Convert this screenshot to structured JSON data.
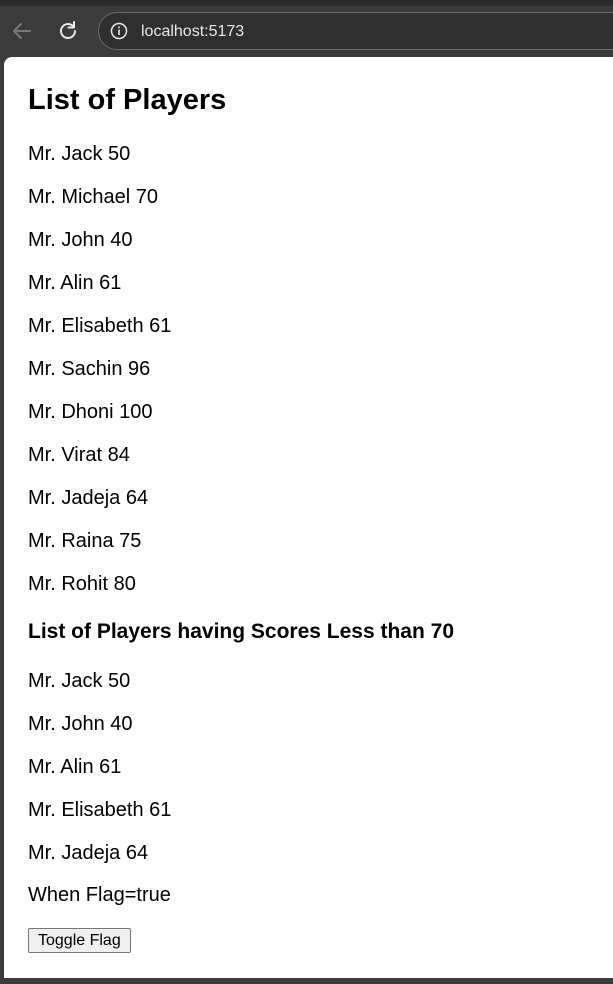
{
  "browser": {
    "url": "localhost:5173"
  },
  "page": {
    "title": "List of Players",
    "all_players": [
      "Mr. Jack 50",
      "Mr. Michael 70",
      "Mr. John 40",
      "Mr. Alin 61",
      "Mr. Elisabeth 61",
      "Mr. Sachin 96",
      "Mr. Dhoni 100",
      "Mr. Virat 84",
      "Mr. Jadeja 64",
      "Mr. Raina 75",
      "Mr. Rohit 80"
    ],
    "filtered_title": "List of Players having Scores Less than 70",
    "filtered_players": [
      "Mr. Jack 50",
      "Mr. John 40",
      "Mr. Alin 61",
      "Mr. Elisabeth 61",
      "Mr. Jadeja 64"
    ],
    "flag_text": "When Flag=true",
    "toggle_button_label": "Toggle Flag"
  },
  "icons": {
    "back": "arrow-left-icon",
    "reload": "reload-icon",
    "site_info": "info-icon"
  }
}
